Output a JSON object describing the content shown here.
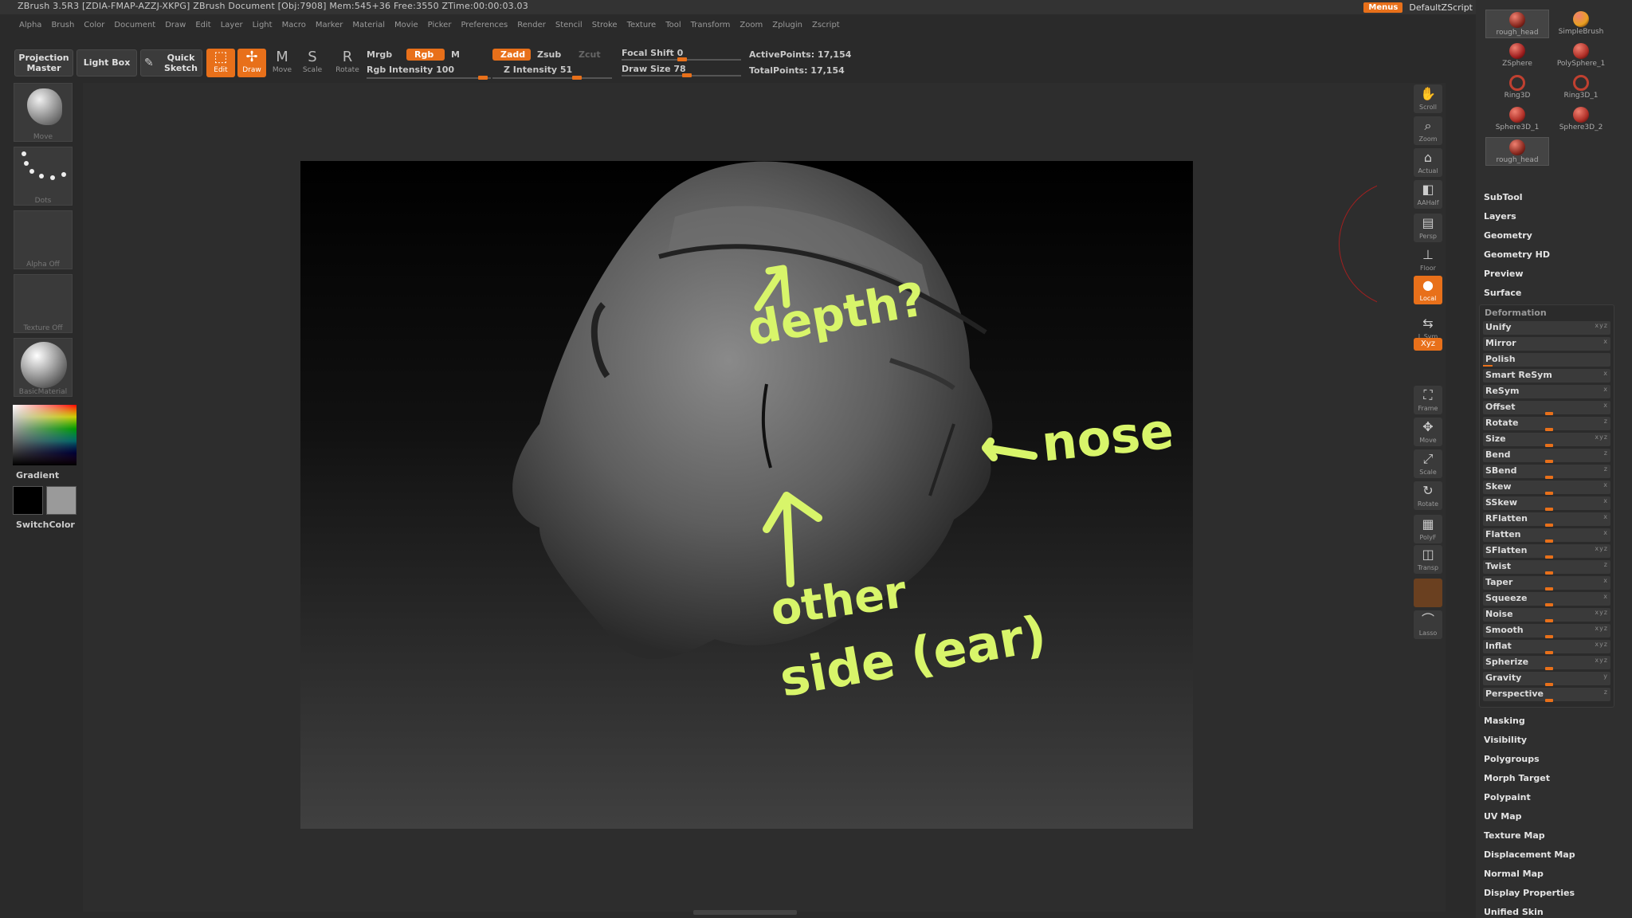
{
  "app": {
    "title": "ZBrush 3.5R3 [ZDIA-FMAP-AZZJ-XKPG]    ZBrush Document    [Obj:7908] Mem:545+36 Free:3550 ZTime:00:00:03.03",
    "menus_button": "Menus",
    "script_label": "DefaultZScript"
  },
  "menubar": [
    "Alpha",
    "Brush",
    "Color",
    "Document",
    "Draw",
    "Edit",
    "Layer",
    "Light",
    "Macro",
    "Marker",
    "Material",
    "Movie",
    "Picker",
    "Preferences",
    "Render",
    "Stencil",
    "Stroke",
    "Texture",
    "Tool",
    "Transform",
    "Zoom",
    "Zplugin",
    "Zscript"
  ],
  "shelf": {
    "projection_master": "Projection Master",
    "light_box": "Light Box",
    "quick_sketch": "Quick Sketch",
    "edit": "Edit",
    "draw": "Draw",
    "move": "Move",
    "scale": "Scale",
    "rotate": "Rotate",
    "mrgb": "Mrgb",
    "rgb": "Rgb",
    "m": "M",
    "rgb_intensity": "Rgb Intensity 100",
    "rgb_intensity_value": 100,
    "zadd": "Zadd",
    "zsub": "Zsub",
    "zcut": "Zcut",
    "z_intensity": "Z Intensity 51",
    "z_intensity_value": 51,
    "focal_shift": "Focal Shift 0",
    "focal_shift_value": 0,
    "draw_size": "Draw Size 78",
    "draw_size_value": 78,
    "active_points": "ActivePoints: 17,154",
    "total_points": "TotalPoints: 17,154"
  },
  "left": {
    "brush": "Move",
    "stroke": "Dots",
    "alpha": "Alpha Off",
    "texture": "Texture Off",
    "material": "BasicMaterial",
    "gradient": "Gradient",
    "switchcolor": "SwitchColor"
  },
  "annotations": {
    "depth": "depth?",
    "nose": "nose",
    "other": "other",
    "side": "side (ear)"
  },
  "dock": [
    "Scroll",
    "Zoom",
    "Actual",
    "AAHalf",
    "Persp",
    "Floor",
    "Local",
    "L.Sym",
    "Xyz",
    "Frame",
    "Move",
    "Scale",
    "Rotate",
    "PolyF",
    "Transp",
    "Lasso"
  ],
  "subtools": [
    {
      "name": "rough_head",
      "color": "#8a2a20"
    },
    {
      "name": "SimpleBrush",
      "color": "#e8a020"
    },
    {
      "name": "ZSphere",
      "color": "#a02020"
    },
    {
      "name": "PolySphere_1",
      "color": "#b03028"
    },
    {
      "name": "Ring3D",
      "color": "#c04030"
    },
    {
      "name": "Ring3D_1",
      "color": "#c04030"
    },
    {
      "name": "Sphere3D_1",
      "color": "#b03028"
    },
    {
      "name": "Sphere3D_2",
      "color": "#b03028"
    },
    {
      "name": "rough_head",
      "color": "#8a2a20"
    }
  ],
  "palette_sections_top": [
    "SubTool",
    "Layers",
    "Geometry",
    "Geometry HD",
    "Preview",
    "Surface"
  ],
  "deformation": {
    "title": "Deformation",
    "items": [
      {
        "name": "Unify",
        "axes": "xyz",
        "value": 0
      },
      {
        "name": "Mirror",
        "axes": "x",
        "value": 0
      },
      {
        "name": "Polish",
        "axes": "",
        "value": 0
      },
      {
        "name": "Smart ReSym",
        "axes": "x",
        "value": 0
      },
      {
        "name": "ReSym",
        "axes": "x",
        "value": 0
      },
      {
        "name": "Offset",
        "axes": "x",
        "value": 0
      },
      {
        "name": "Rotate",
        "axes": "z",
        "value": 0
      },
      {
        "name": "Size",
        "axes": "xyz",
        "value": 0
      },
      {
        "name": "Bend",
        "axes": "z",
        "value": 0
      },
      {
        "name": "SBend",
        "axes": "z",
        "value": 0
      },
      {
        "name": "Skew",
        "axes": "x",
        "value": 0
      },
      {
        "name": "SSkew",
        "axes": "x",
        "value": 0
      },
      {
        "name": "RFlatten",
        "axes": "x",
        "value": 0
      },
      {
        "name": "Flatten",
        "axes": "x",
        "value": 0
      },
      {
        "name": "SFlatten",
        "axes": "xyz",
        "value": 0
      },
      {
        "name": "Twist",
        "axes": "z",
        "value": 0
      },
      {
        "name": "Taper",
        "axes": "x",
        "value": 0
      },
      {
        "name": "Squeeze",
        "axes": "x",
        "value": 0
      },
      {
        "name": "Noise",
        "axes": "xyz",
        "value": 0
      },
      {
        "name": "Smooth",
        "axes": "xyz",
        "value": 0
      },
      {
        "name": "Inflat",
        "axes": "xyz",
        "value": 0
      },
      {
        "name": "Spherize",
        "axes": "xyz",
        "value": 0
      },
      {
        "name": "Gravity",
        "axes": "y",
        "value": 0
      },
      {
        "name": "Perspective",
        "axes": "z",
        "value": 0
      }
    ]
  },
  "palette_sections_bottom": [
    "Masking",
    "Visibility",
    "Polygroups",
    "Morph Target",
    "Polypaint",
    "UV Map",
    "Texture Map",
    "Displacement Map",
    "Normal Map",
    "Display Properties",
    "Unified Skin"
  ],
  "colors": {
    "accent": "#e8701a",
    "annotation": "#d8f56a"
  }
}
